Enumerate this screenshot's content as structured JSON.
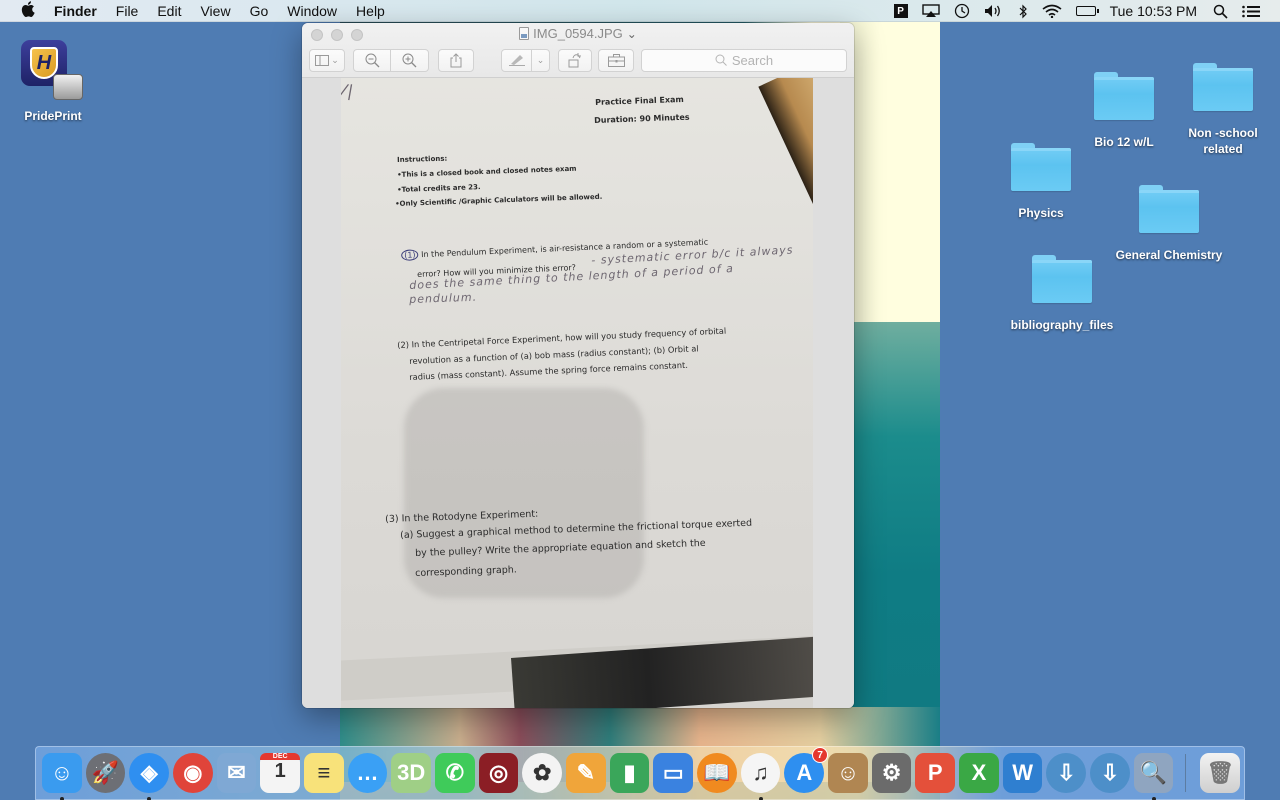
{
  "menubar": {
    "apple_icon": "",
    "app_name": "Finder",
    "menus": [
      "File",
      "Edit",
      "View",
      "Go",
      "Window",
      "Help"
    ],
    "status_icons": [
      {
        "name": "pridePrint-status-icon",
        "glyph": "P"
      },
      {
        "name": "airplay-icon",
        "glyph": "⏏"
      },
      {
        "name": "time-machine-icon",
        "glyph": "◷"
      },
      {
        "name": "volume-icon",
        "glyph": "🔊"
      },
      {
        "name": "bluetooth-icon",
        "glyph": "ᛒ"
      },
      {
        "name": "wifi-icon",
        "glyph": "◠"
      }
    ],
    "clock": "Tue 10:53 PM",
    "spotlight_icon": "⌕",
    "notification_icon": "☰"
  },
  "desktop": {
    "icons": [
      {
        "label": "PridePrint",
        "type": "app"
      },
      {
        "label": "Bio 12 w/L",
        "type": "folder"
      },
      {
        "label": "Non -school related",
        "type": "folder"
      },
      {
        "label": "Physics",
        "type": "folder"
      },
      {
        "label": "General Chemistry",
        "type": "folder"
      },
      {
        "label": "bibliography_files",
        "type": "folder"
      }
    ]
  },
  "preview": {
    "title": "IMG_0594.JPG",
    "title_chevron": "⌄",
    "toolbar": {
      "sidebar_icon": "▯",
      "sidebar_chevron": "⌄",
      "zoom_out_icon": "⊖",
      "zoom_in_icon": "⊕",
      "share_icon": "⇧",
      "markup_icon": "✎",
      "markup_chevron": "⌄",
      "rotate_icon": "↺",
      "toolbox_icon": "⌸",
      "search_placeholder": "Search",
      "search_icon": "⌕"
    },
    "document": {
      "header_title": "Practice Final Exam",
      "header_duration": "Duration: 90 Minutes",
      "instructions_label": "Instructions:",
      "instructions": [
        "•This is a closed book and closed notes exam",
        "•Total credits are 23.",
        "•Only Scientific /Graphic Calculators will be allowed."
      ],
      "q1_number": "(1)",
      "q1_line1": "In the Pendulum Experiment, is air-resistance a random or a systematic",
      "q1_line2": "error? How will you minimize this error?",
      "q1_answer_line1": "- systematic   error  b/c  it always",
      "q1_answer_line2": "does the same thing  to the length  of a  period of a",
      "q1_answer_line3": "pendulum.",
      "q2_line1": "(2) In the Centripetal Force Experiment, how will you study frequency of orbital",
      "q2_line2": "revolution as a function of (a) bob mass   (radius constant); (b) Orbit al",
      "q2_line3": "radius (mass constant).  Assume the spring force remains constant.",
      "q3_line1": "(3) In the Rotodyne Experiment:",
      "q3_line2": "(a) Suggest a graphical method to determine the frictional torque exerted",
      "q3_line3": "by the pulley?  Write the appropriate equation and sketch the",
      "q3_line4": "corresponding graph."
    }
  },
  "dock": {
    "apps": [
      {
        "name": "Finder",
        "glyph": "☺",
        "color": "#3a9bef",
        "running": true
      },
      {
        "name": "Launchpad",
        "glyph": "🚀",
        "color": "#6d6f75",
        "running": false,
        "round": true
      },
      {
        "name": "Safari",
        "glyph": "◈",
        "color": "#2f8ff0",
        "running": true,
        "round": true
      },
      {
        "name": "Chrome",
        "glyph": "◉",
        "color": "#e0443a",
        "running": false,
        "round": true
      },
      {
        "name": "Mail",
        "glyph": "✉",
        "color": "#7fa8d4",
        "running": false
      },
      {
        "name": "Calendar",
        "glyph": "1",
        "color": "#f4f4f4",
        "running": false,
        "month": "DEC"
      },
      {
        "name": "Notes",
        "glyph": "≡",
        "color": "#f8e27a",
        "running": false
      },
      {
        "name": "Messages",
        "glyph": "…",
        "color": "#3aa0f5",
        "running": false,
        "round": true
      },
      {
        "name": "Maps",
        "glyph": "3D",
        "color": "#9fcf86",
        "running": false
      },
      {
        "name": "FaceTime",
        "glyph": "✆",
        "color": "#3fcb5a",
        "running": false
      },
      {
        "name": "Photo Booth",
        "glyph": "◎",
        "color": "#8b1e25",
        "running": false
      },
      {
        "name": "Photos",
        "glyph": "✿",
        "color": "#f3f3f3",
        "running": false,
        "round": true
      },
      {
        "name": "Pages",
        "glyph": "✎",
        "color": "#f0a53a",
        "running": false
      },
      {
        "name": "Numbers",
        "glyph": "▮",
        "color": "#3aa65a",
        "running": false
      },
      {
        "name": "Keynote",
        "glyph": "▭",
        "color": "#3a82e0",
        "running": false
      },
      {
        "name": "iBooks",
        "glyph": "📖",
        "color": "#f08a1f",
        "running": false,
        "round": true
      },
      {
        "name": "iTunes",
        "glyph": "♫",
        "color": "#f5f5f5",
        "running": true,
        "round": true
      },
      {
        "name": "App Store",
        "glyph": "A",
        "color": "#2e8ff0",
        "running": false,
        "round": true,
        "badge": "7"
      },
      {
        "name": "Contacts",
        "glyph": "☺",
        "color": "#b08652",
        "running": false
      },
      {
        "name": "System Preferences",
        "glyph": "⚙",
        "color": "#6b6b6b",
        "running": false
      },
      {
        "name": "PowerPoint",
        "glyph": "P",
        "color": "#e4503a",
        "running": false
      },
      {
        "name": "Excel",
        "glyph": "X",
        "color": "#3aa845",
        "running": false
      },
      {
        "name": "Word",
        "glyph": "W",
        "color": "#2f7fd0",
        "running": false
      },
      {
        "name": "Downloader 1",
        "glyph": "⇩",
        "color": "#4d8fc9",
        "running": false,
        "round": true
      },
      {
        "name": "Downloader 2",
        "glyph": "⇩",
        "color": "#4d8fc9",
        "running": false,
        "round": true
      },
      {
        "name": "Preview",
        "glyph": "🔍",
        "color": "#8fa5c0",
        "running": true
      }
    ],
    "trash": {
      "name": "Trash",
      "glyph": "🗑"
    }
  }
}
